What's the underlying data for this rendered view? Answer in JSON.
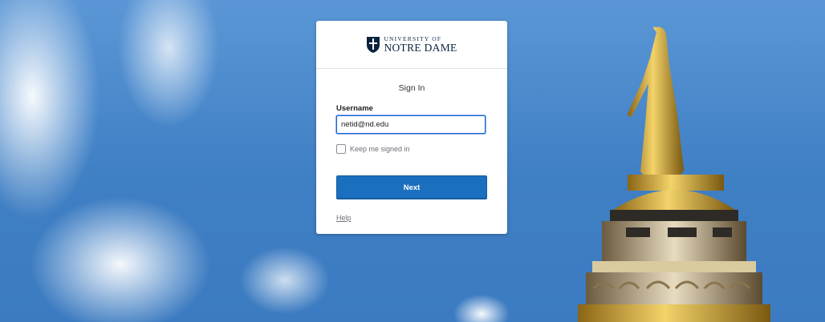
{
  "brand": {
    "logo_top": "UNIVERSITY OF",
    "logo_bottom": "NOTRE DAME",
    "icon": "shield-crest-icon"
  },
  "form": {
    "title": "Sign In",
    "username_label": "Username",
    "username_value": "netid@nd.edu",
    "keep_signed_in_label": "Keep me signed in",
    "keep_signed_in_checked": false,
    "next_label": "Next",
    "help_label": "Help"
  },
  "colors": {
    "accent": "#1b6fbf",
    "brand_navy": "#0c2340",
    "sky": "#3f7fc4",
    "gold": "#d4a93a"
  }
}
